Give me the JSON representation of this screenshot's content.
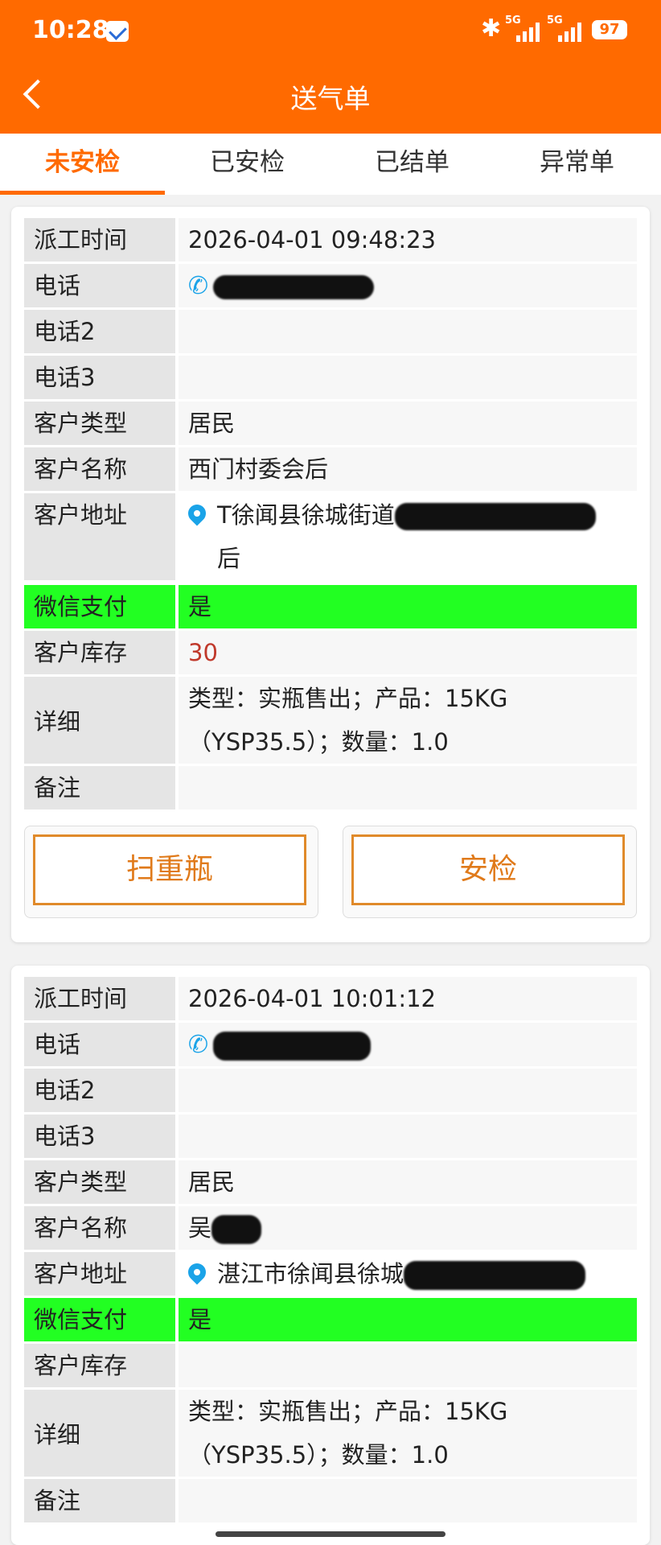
{
  "status_bar": {
    "time": "10:28",
    "signal1": "5G",
    "signal2": "5G",
    "battery": "97"
  },
  "header": {
    "title": "送气单"
  },
  "tabs": [
    {
      "label": "未安检",
      "active": true
    },
    {
      "label": "已安检"
    },
    {
      "label": "已结单"
    },
    {
      "label": "异常单"
    }
  ],
  "labels": {
    "dispatch_time": "派工时间",
    "phone": "电话",
    "phone2": "电话2",
    "phone3": "电话3",
    "customer_type": "客户类型",
    "customer_name": "客户名称",
    "customer_address": "客户地址",
    "wechat_pay": "微信支付",
    "customer_stock": "客户库存",
    "detail": "详细",
    "remark": "备注"
  },
  "orders": [
    {
      "dispatch_time": "2026-04-01 09:48:23",
      "phone": "",
      "phone2": "",
      "phone3": "",
      "customer_type": "居民",
      "customer_name": "西门村委会后",
      "customer_address_visible": "T徐闻县徐城街道",
      "customer_address_tail": "后",
      "wechat_pay": "是",
      "customer_stock": "30",
      "detail_line1": "类型：实瓶售出；产品：15KG",
      "detail_line2": "（YSP35.5）；数量：1.0",
      "remark": "",
      "btn_scan": "扫重瓶",
      "btn_check": "安检"
    },
    {
      "dispatch_time": "2026-04-01 10:01:12",
      "phone": "",
      "phone2": "",
      "phone3": "",
      "customer_type": "居民",
      "customer_name_visible": "吴",
      "customer_address_visible": "湛江市徐闻县徐城",
      "wechat_pay": "是",
      "customer_stock": "",
      "detail_line1": "类型：实瓶售出；产品：15KG",
      "detail_line2": "（YSP35.5）；数量：1.0"
    }
  ],
  "colors": {
    "primary": "#ff6a00",
    "wechat_green": "#22ff22",
    "stock_red": "#c0392b",
    "icon_blue": "#1aa3e8"
  }
}
